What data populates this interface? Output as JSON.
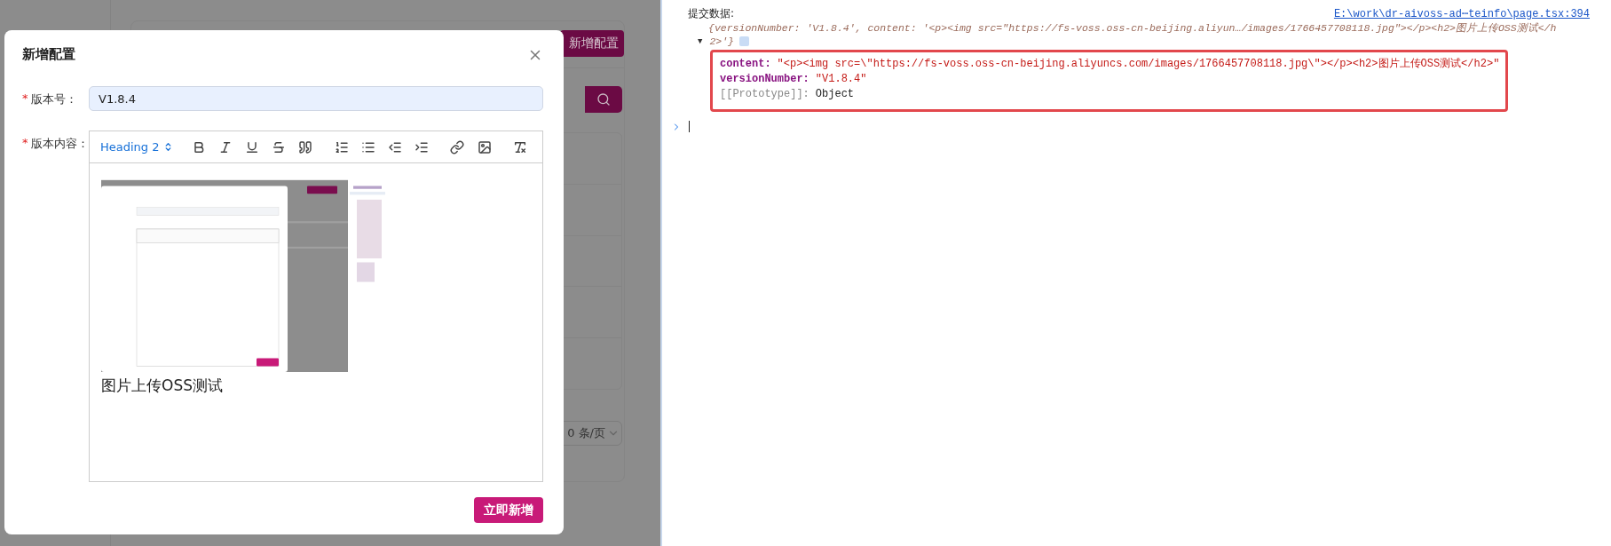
{
  "background_page": {
    "add_button": "新增配置",
    "page_size": "0 条/页"
  },
  "dialog": {
    "title": "新增配置",
    "fields": [
      {
        "kind": "input",
        "mark": "*",
        "label": "版本号：",
        "value": "V1.8.4"
      },
      {
        "kind": "editor",
        "mark": "*",
        "label": "版本内容："
      }
    ],
    "editor": {
      "heading_select": "Heading 2",
      "content": [
        {
          "kind": "picture"
        },
        {
          "kind": "heading",
          "text": "图片上传OSS测试"
        }
      ]
    },
    "submit": "立即新增"
  },
  "console": {
    "label": "提交数据:",
    "source_link": "E:\\work\\dr-aivoss-ad⋯teinfo\\page.tsx:394",
    "preview_lines": [
      "{versionNumber: 'V1.8.4', content: '<p><img src=\"https://fs-voss.oss-cn-beijing.aliyun…/images/1766457708118.jpg\"></p><h2>图片上传OSS测试</h",
      "2>'}"
    ],
    "expanded": true,
    "expand_glyph": "▼",
    "properties": [
      {
        "key": "content:",
        "value": "\"<p><img src=\\\"https://fs-voss.oss-cn-beijing.aliyuncs.com/images/1766457708118.jpg\\\"></p><h2>图片上传OSS测试</h2>\""
      },
      {
        "key": "versionNumber:",
        "value": "\"V1.8.4\""
      }
    ],
    "prototype": {
      "key": "[[Prototype]]:",
      "value": "Object"
    }
  }
}
